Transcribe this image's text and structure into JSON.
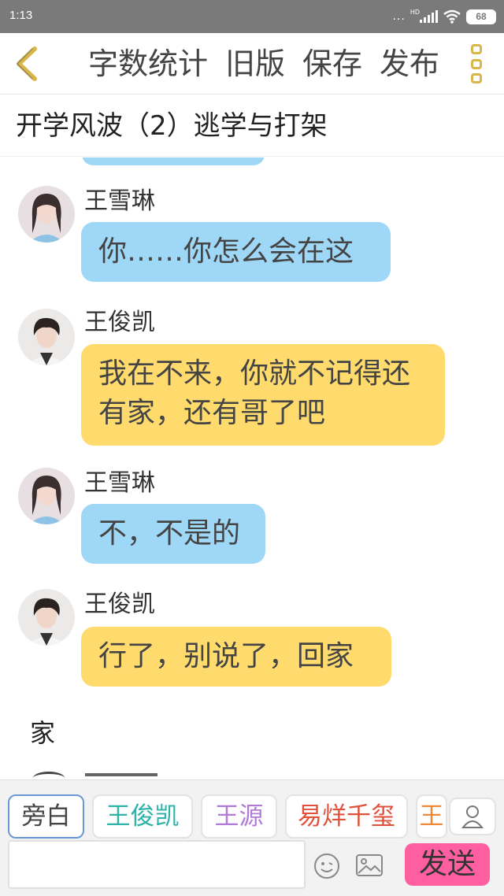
{
  "status_bar": {
    "time": "1:13",
    "dots": "...",
    "network": "HD",
    "battery": "68"
  },
  "toolbar": {
    "word_count": "字数统计",
    "old_version": "旧版",
    "save": "保存",
    "publish": "发布",
    "back_icon": "chevron-left-icon",
    "more_icon": "more-vertical-icon",
    "accent": "#d9b64a"
  },
  "story": {
    "title": "开学风波（2）逃学与打架"
  },
  "messages": [
    {
      "speaker": "王雪琳",
      "text": "你……你怎么会在这",
      "color": "#9fd8f7"
    },
    {
      "speaker": "王俊凯",
      "text": "我在不来，你就不记得还有家，还有哥了吧",
      "color": "#ffdb6e"
    },
    {
      "speaker": "王雪琳",
      "text": "不，不是的",
      "color": "#9fd8f7"
    },
    {
      "speaker": "王俊凯",
      "text": "行了，别说了，回家",
      "color": "#ffdb6e"
    }
  ],
  "narration": "家",
  "roles": [
    {
      "label": "旁白",
      "color": "#555555"
    },
    {
      "label": "王俊凯",
      "color": "#2eb3a8"
    },
    {
      "label": "王源",
      "color": "#b07ad6"
    },
    {
      "label": "易烊千玺",
      "color": "#e0503a"
    },
    {
      "label": "王",
      "color": "#f08a3a"
    }
  ],
  "composer": {
    "placeholder": "",
    "emoji_icon": "smiley-icon",
    "image_icon": "image-icon",
    "send": "发送",
    "send_color": "#ff5fa0"
  }
}
